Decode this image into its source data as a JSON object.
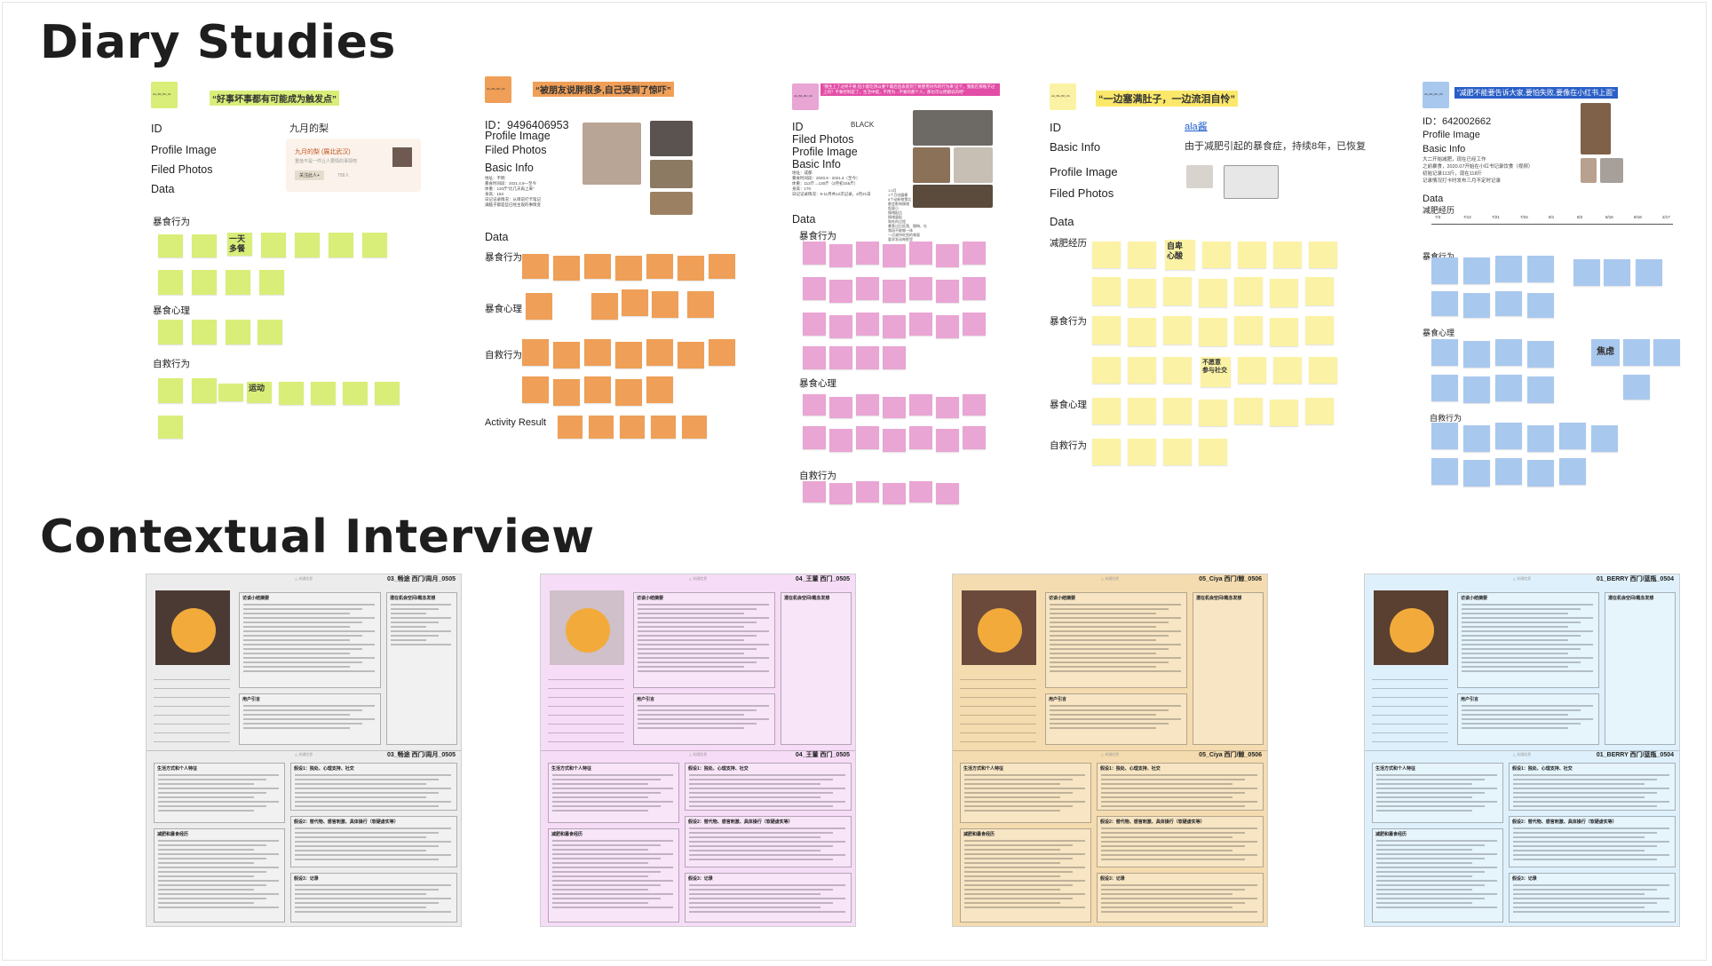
{
  "sections": {
    "diary_title": "Diary Studies",
    "contextual_title": "Contextual Interview"
  },
  "colors": {
    "yellow_green": "#d8ee79",
    "orange": "#ef9f57",
    "pink": "#e9a5d3",
    "yellow": "#fbf2a5",
    "blue": "#a9c8ee",
    "ci_gray": "#ececec",
    "ci_pink": "#f6dcf6",
    "ci_tan": "#f4dcb0",
    "ci_blue": "#def0fb",
    "face": "#f2ab3b"
  },
  "diary": {
    "p1": {
      "head_tag": "AA_BA_BC_01",
      "quote": "“好事坏事都有可能成为触发点”",
      "fields": {
        "id": "ID",
        "profile": "Profile Image",
        "filed": "Filed Photos",
        "data": "Data"
      },
      "id_value": "九月的梨",
      "card_name": "九月的梨 (展北武汉)",
      "card_sub": "重拾不是一件让人要情的事情吧",
      "card_btn": "关注此人+",
      "card_count": "758人",
      "groups": [
        "暴食行为",
        "暴食心理",
        "自救行为"
      ],
      "big_notes": [
        "一天多餐",
        "运动"
      ]
    },
    "p2": {
      "head_tag": "AA_BA_BC_02",
      "quote": "“被朋友说胖很多,自己受到了惊吓”",
      "id_line": "ID：9496406953",
      "fields": {
        "profile": "Profile Image",
        "filed": "Filed Photos",
        "basic": "Basic Info",
        "data": "Data"
      },
      "basic_lines": [
        "地址：不明",
        "暴食时间段：2021.4.9—至今",
        "体重：120斤“比几天再上来”",
        "身高：153",
        "日记记录情况：从目前打卡笔记",
        "满脑子都是些已经主观的事情变"
      ],
      "groups": [
        "暴食行为",
        "暴食心理",
        "自救行为",
        "Activity Result"
      ]
    },
    "p3": {
      "head_tag": "AA_BA_BC_03",
      "quote": "“我生上了过终于要,但小套吃饼以要个最后直表底到了要使用对作的行为来”这个，我能在那瓶子过上的？不要控制是了，生活中提，不用为…不要的那个人，那也可以把都说的吧”",
      "fields": {
        "id": "ID",
        "filed": "Filed Photos",
        "profile": "Profile Image",
        "basic": "Basic Info",
        "data": "Data"
      },
      "id_value": "BLACK",
      "basic_lines": [
        "地址：成都",
        "暴食时间段：2020.9 - 2021.4（至今）",
        "体重：112斤→130斤（2月初155斤）",
        "身高：170",
        "日记记录情况：9-11月共12次记录，4月21日"
      ],
      "groups": [
        "暴食行为",
        "暴食心理",
        "自救行为"
      ],
      "note_lines": [
        "1.5月",
        "1个月份圆桶",
        "8个动新物零比",
        "都会影响情绪",
        "饭量小",
        "情绪配比",
        "情绪量配",
        "和吃的过程",
        "暴食过后低落、懊悔、吐",
        "频段不能够一体",
        "一点减持吃到的餐量",
        "要求发动每那里"
      ]
    },
    "p4": {
      "head_tag": "AA_BA_BC_04",
      "quote": "“一边塞满肚子，一边流泪自怜”",
      "fields": {
        "id": "ID",
        "basic": "Basic Info",
        "profile": "Profile Image",
        "filed": "Filed Photos",
        "data": "Data"
      },
      "id_value": "ala酱",
      "basic_value": "由于减肥引起的暴食症，持续8年，已恢复",
      "groups": [
        "减肥经历",
        "暴食行为",
        "暴食心理",
        "自救行为"
      ],
      "big_notes": [
        "自卑\n心酸",
        "不愿意\n参与社交"
      ]
    },
    "p5": {
      "head_tag": "AA_BA_BC_05",
      "quote": "“减肥不能要告诉大家,要怕失败,要像在小红书上面”",
      "id_line": "ID：642002662",
      "fields": {
        "profile": "Profile Image",
        "basic": "Basic Info",
        "data": "Data"
      },
      "basic_lines": [
        "大二开始减肥，现在已经工作",
        "之前暴食，2020.07开始在小红书记录饮食（视频）",
        "初始记录113斤，现在118斤",
        "记录情况打卡时发布三月不定时记录"
      ],
      "sub_title": "减肥经历",
      "timeline": [
        "7/3",
        "7/12",
        "7/21",
        "7/24",
        "8/1",
        "8/2",
        "8/16",
        "8/18",
        "2/17"
      ],
      "groups": [
        "暴食行为",
        "暴食心理",
        "自救行为"
      ],
      "big_notes": [
        "焦虑"
      ]
    }
  },
  "interviews": [
    {
      "header_top": "03_畅途 西门/周月_0505",
      "header_bottom": "03_畅途 西门/周月_0505",
      "top_tag": "△ 关键信息",
      "mid_tag": "△ 关键信息",
      "box_labels": [
        "访谈小结摘要",
        "潜在机会空间/概念发想",
        "用户引言",
        "生活方式和个人特征",
        "假设1：独处、心理支持、社交",
        "假设2：替代物、感官刺激、具体操行（软硬虚实等）",
        "减肥和暴食经历",
        "假设3：记录"
      ]
    },
    {
      "header_top": "04_王董 西门_0505",
      "header_bottom": "04_王董 西门_0505",
      "top_tag": "△ 关键信息",
      "mid_tag": "△ 关键信息",
      "box_labels": [
        "访谈小结摘要",
        "潜在机会空间/概念发想",
        "用户引言",
        "生活方式和个人特征",
        "假设1：独处、心理支持、社交",
        "假设2：替代物、感官刺激、具体操行（软硬虚实等）",
        "减肥和暴食经历",
        "假设3：记录"
      ]
    },
    {
      "header_top": "05_Ciya 西门/鲸_0506",
      "header_bottom": "05_Ciya 西门/鲸_0506",
      "top_tag": "△ 关键信息",
      "mid_tag": "△ 关键信息",
      "box_labels": [
        "访谈小结摘要",
        "潜在机会空间/概念发想",
        "用户引言",
        "生活方式和个人特征",
        "假设1：独处、心理支持、社交",
        "假设2：替代物、感官刺激、具体操行（软硬虚实等）",
        "减肥和暴食经历",
        "假设3：记录"
      ]
    },
    {
      "header_top": "01_BERRY 西门/蓝瓶_0504",
      "header_bottom": "01_BERRY 西门/蓝瓶_0504",
      "top_tag": "△ 关键信息",
      "mid_tag": "△ 关键信息",
      "box_labels": [
        "访谈小结摘要",
        "潜在机会空间/概念发想",
        "用户引言",
        "生活方式和个人特征",
        "假设1：独处、心理支持、社交",
        "假设2：替代物、感官刺激、具体操行（软硬虚实等）",
        "减肥和暴食经历",
        "假设3：记录"
      ]
    }
  ]
}
